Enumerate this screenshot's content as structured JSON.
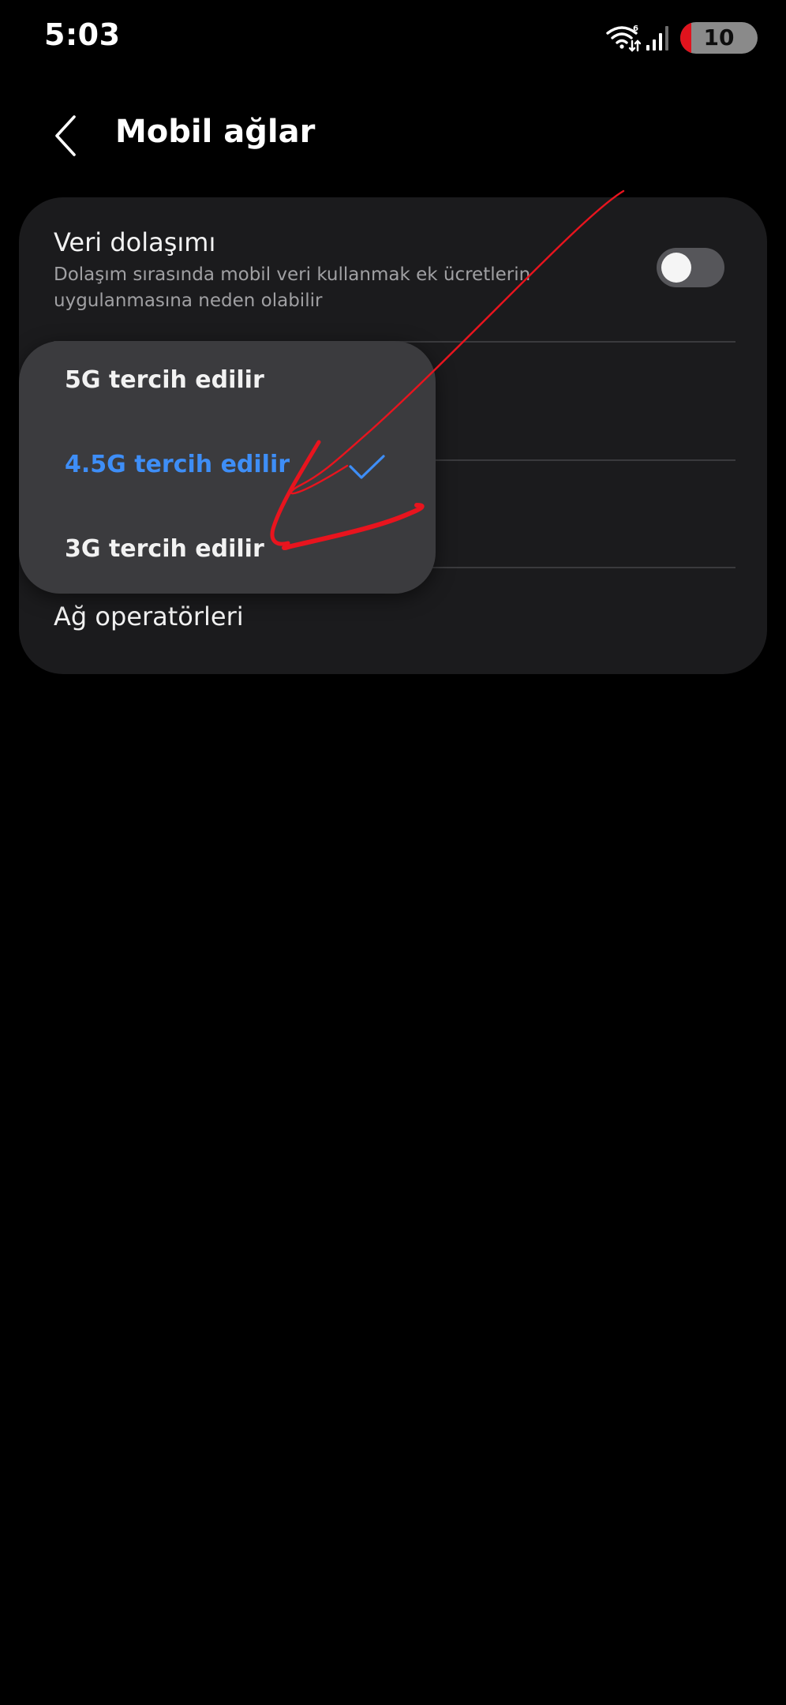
{
  "status_bar": {
    "time": "5:03",
    "battery_percent": "10",
    "battery_level": 0.1,
    "battery_color": "#e0131d",
    "icons": [
      "wifi-icon",
      "signal-icon",
      "battery-icon"
    ]
  },
  "header": {
    "back_icon": "chevron-left-icon",
    "title": "Mobil ağlar"
  },
  "settings": {
    "roaming": {
      "title": "Veri dolaşımı",
      "description": "Dolaşım sırasında mobil veri kullanmak ek ücretlerin uygulanmasına neden olabilir",
      "enabled": false
    },
    "operators_label": "Ağ operatörleri"
  },
  "network_mode_menu": {
    "options": [
      {
        "label": "5G tercih edilir",
        "selected": false
      },
      {
        "label": "4.5G tercih edilir",
        "selected": true
      },
      {
        "label": "3G tercih edilir",
        "selected": false
      }
    ],
    "selected_color": "#3e8ef7",
    "check_icon": "checkmark-icon"
  },
  "annotation": {
    "type": "hand-drawn-arrow",
    "color": "#e8141e"
  }
}
